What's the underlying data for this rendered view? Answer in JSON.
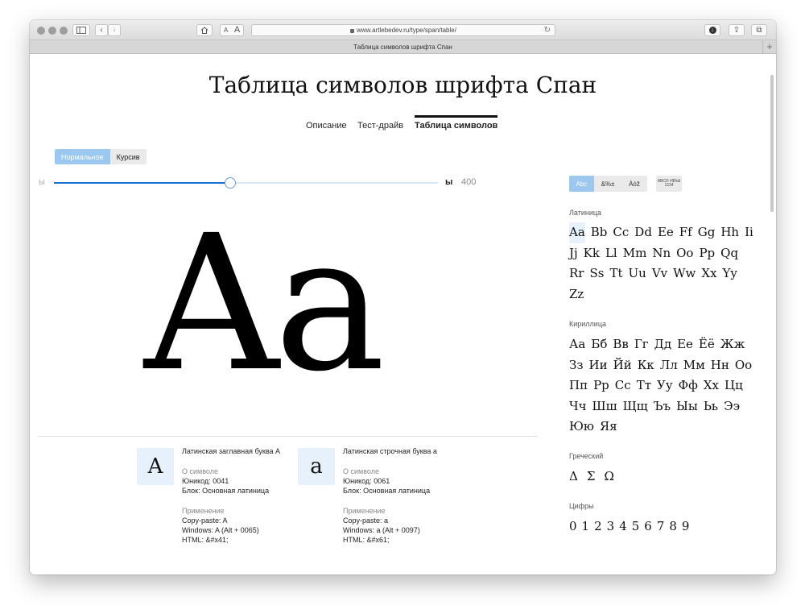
{
  "browser": {
    "url": "www.artlebedev.ru/type/span/table/",
    "tab_title": "Таблица символов шрифта Спан",
    "text_size_small": "A",
    "text_size_large": "A"
  },
  "page": {
    "title": "Таблица символов шрифта Спан",
    "nav": [
      {
        "label": "Описание",
        "active": false
      },
      {
        "label": "Тест-драйв",
        "active": false
      },
      {
        "label": "Таблица символов",
        "active": true
      }
    ],
    "style_toggle": {
      "normal": "Нормальное",
      "italic": "Курсив",
      "selected": "normal"
    },
    "weight": {
      "light_label": "ы",
      "bold_label": "ы",
      "value": "400",
      "fraction": 0.46
    },
    "preview_glyph": "Aa"
  },
  "char_cards": [
    {
      "glyph": "A",
      "title": "Латинская заглавная буква A",
      "about_heading": "О символе",
      "unicode": "Юникод: 0041",
      "block": "Блок: Основная латиница",
      "usage_heading": "Применение",
      "copy_paste": "Copy-paste: A",
      "windows": "Windows: A (Alt + 0065)",
      "html": "HTML: &#x41;"
    },
    {
      "glyph": "a",
      "title": "Латинская строчная буква a",
      "about_heading": "О символе",
      "unicode": "Юникод: 0061",
      "block": "Блок: Основная латиница",
      "usage_heading": "Применение",
      "copy_paste": "Copy-paste: a",
      "windows": "Windows: a (Alt + 0097)",
      "html": "HTML: &#x61;"
    }
  ],
  "charset_tabs": [
    {
      "label": "Abc",
      "active": true
    },
    {
      "label": "&%±",
      "active": false
    },
    {
      "label": "Àòž",
      "active": false
    },
    {
      "label": "ABCD #$%& 1234",
      "active": false
    }
  ],
  "groups": {
    "latin": {
      "label": "Латиница",
      "glyphs": [
        "Aa",
        "Bb",
        "Cc",
        "Dd",
        "Ee",
        "Ff",
        "Gg",
        "Hh",
        "Ii",
        "Jj",
        "Kk",
        "Ll",
        "Mm",
        "Nn",
        "Oo",
        "Pp",
        "Qq",
        "Rr",
        "Ss",
        "Tt",
        "Uu",
        "Vv",
        "Ww",
        "Xx",
        "Yy",
        "Zz"
      ]
    },
    "cyrillic": {
      "label": "Кириллица",
      "glyphs": [
        "Аа",
        "Бб",
        "Вв",
        "Гг",
        "Дд",
        "Ее",
        "Ёё",
        "Жж",
        "Зз",
        "Ии",
        "Йй",
        "Кк",
        "Лл",
        "Мм",
        "Нн",
        "Оо",
        "Пп",
        "Рр",
        "Сс",
        "Тт",
        "Уу",
        "Фф",
        "Хх",
        "Цц",
        "Чч",
        "Шш",
        "Щщ",
        "Ъъ",
        "Ыы",
        "Ьь",
        "Ээ",
        "Юю",
        "Яя"
      ]
    },
    "greek": {
      "label": "Греческий",
      "glyphs": [
        "Δ",
        "Σ",
        "Ω"
      ]
    },
    "digits": {
      "label": "Цифры",
      "glyphs": [
        "0",
        "1",
        "2",
        "3",
        "4",
        "5",
        "6",
        "7",
        "8",
        "9"
      ]
    }
  },
  "colors": {
    "accent": "#9cc8ef",
    "slider": "#1a6fd0",
    "swatch_bg": "#e7f1fb"
  }
}
